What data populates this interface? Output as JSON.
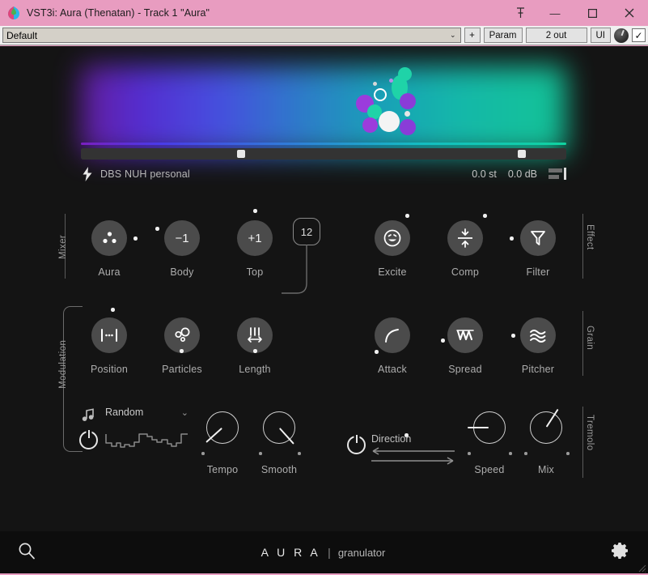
{
  "window": {
    "title": "VST3i: Aura (Thenatan) - Track 1 \"Aura\"",
    "icon": "aura-leaf-icon",
    "pin_label": "⟰",
    "minimize_label": "—",
    "maximize_label": "☐",
    "close_label": "✕",
    "titlebar_color": "#e89cc0"
  },
  "toolbar": {
    "preset_value": "Default",
    "preset_caret": "⌄",
    "add_label": "+",
    "param_label": "Param",
    "output_label": "2 out",
    "ui_label": "UI",
    "knob_name": "host-knob",
    "check_label": "✓"
  },
  "hero": {
    "slider_left_pct": 33,
    "slider_right_pct": 91,
    "gradient_from": "#6a1ea8",
    "gradient_to": "#12cfa2"
  },
  "info": {
    "sample_name": "DBS NUH personal",
    "pitch": "0.0 st",
    "gain": "0.0 dB"
  },
  "rails": {
    "mixer": "Mixer",
    "effect": "Effect",
    "modulation": "Modulation",
    "grain": "Grain",
    "tremolo": "Tremolo"
  },
  "row1": {
    "left": [
      {
        "label": "Aura",
        "icon": "three-dots-icon",
        "value": ""
      },
      {
        "label": "Body",
        "icon": "",
        "value": "−1"
      },
      {
        "label": "Top",
        "icon": "",
        "value": "+1"
      }
    ],
    "badge": "12",
    "right": [
      {
        "label": "Excite",
        "icon": "smiley-icon"
      },
      {
        "label": "Comp",
        "icon": "compress-icon"
      },
      {
        "label": "Filter",
        "icon": "funnel-icon"
      }
    ]
  },
  "row2": {
    "left": [
      {
        "label": "Position",
        "icon": "position-markers-icon"
      },
      {
        "label": "Particles",
        "icon": "particles-icon"
      },
      {
        "label": "Length",
        "icon": "length-arrows-icon"
      }
    ],
    "right": [
      {
        "label": "Attack",
        "icon": "attack-curve-icon"
      },
      {
        "label": "Spread",
        "icon": "zigzag-icon"
      },
      {
        "label": "Pitcher",
        "icon": "waves-icon"
      }
    ]
  },
  "row3": {
    "lfo_shape": "Random",
    "lfo_caret": "⌄",
    "note_icon": "music-note-icon",
    "power_icon": "power-icon",
    "knobs_left": [
      {
        "label": "Tempo",
        "angle": -132
      },
      {
        "label": "Smooth",
        "angle": 138
      }
    ],
    "tremolo_power_icon": "power-icon",
    "direction_label": "Direction",
    "knobs_right": [
      {
        "label": "Speed",
        "angle": -90
      },
      {
        "label": "Mix",
        "angle": 33
      }
    ]
  },
  "footer": {
    "search_icon": "search-icon",
    "brand": "A U R A",
    "brand_separator": "|",
    "brand_sub": "granulator",
    "settings_icon": "gear-icon"
  }
}
